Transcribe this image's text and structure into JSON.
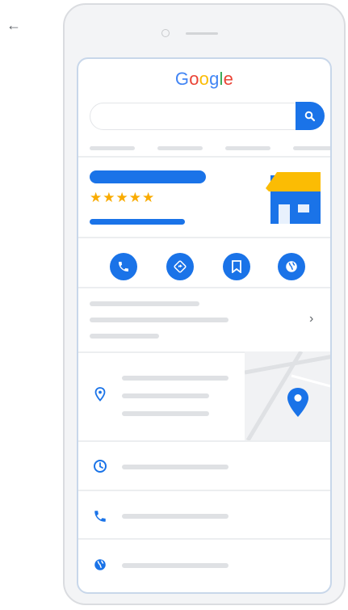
{
  "back_icon": "arrow-left-icon",
  "brand": {
    "letters": [
      "G",
      "o",
      "o",
      "g",
      "l",
      "e"
    ],
    "colors": [
      "#4285f4",
      "#ea4335",
      "#fbbc05",
      "#4285f4",
      "#34a853",
      "#ea4335"
    ]
  },
  "search": {
    "value": "",
    "icon": "magnifier-icon"
  },
  "business": {
    "stars": "★★★★★",
    "rating": 5,
    "store_icon": "storefront-icon"
  },
  "actions": [
    {
      "icon": "phone-icon"
    },
    {
      "icon": "directions-icon"
    },
    {
      "icon": "bookmark-icon"
    },
    {
      "icon": "globe-icon"
    }
  ],
  "info_rows": [
    {
      "icon": "location-pin-icon"
    },
    {
      "icon": "clock-icon"
    },
    {
      "icon": "phone-icon"
    },
    {
      "icon": "globe-icon"
    }
  ],
  "map": {
    "icon": "map-pin-icon"
  },
  "colors": {
    "accent": "#1a73e8",
    "star": "#f9ab00",
    "placeholder": "#dfe1e4",
    "store_awning": "#fbbc04",
    "store_body": "#1a73e8"
  }
}
